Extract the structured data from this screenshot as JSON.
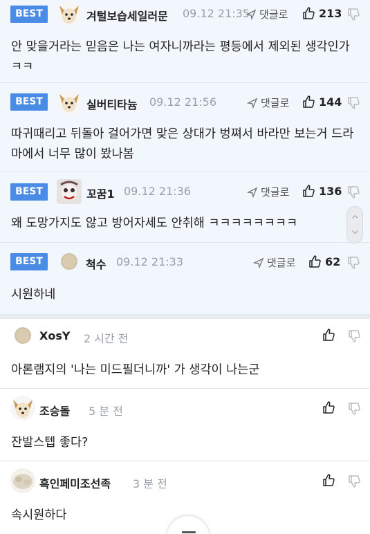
{
  "best_comments": [
    {
      "badge": "BEST",
      "author": "겨털보습세일러문",
      "date": "09.12 21:35",
      "reply_label": "댓글로",
      "likes": "213",
      "text": "안 맞을거라는 믿음은 나는 여자니까라는 평등에서 제외된 생각인가ㅋㅋ",
      "avatar": "dog-avatar"
    },
    {
      "badge": "BEST",
      "author": "실버티타늄",
      "date": "09.12 21:56",
      "reply_label": "댓글로",
      "likes": "144",
      "text": "따귀때리고 뒤돌아 걸어가면 맞은 상대가 벙쪄서 바라만 보는거 드라마에서 너무 많이 봤나봄",
      "avatar": "dog-avatar"
    },
    {
      "badge": "BEST",
      "author": "꼬꿈1",
      "date": "09.12 21:36",
      "reply_label": "댓글로",
      "likes": "136",
      "text": "왜 도망가지도 않고 방어자세도 안취해 ㅋㅋㅋㅋㅋㅋㅋㅋ",
      "avatar": "clown-avatar"
    },
    {
      "badge": "BEST",
      "author": "척수",
      "date": "09.12 21:33",
      "reply_label": "댓글로",
      "likes": "62",
      "text": "시원하네",
      "avatar": "default-avatar"
    }
  ],
  "comments": [
    {
      "author": "XosY",
      "date": "2 시간 전",
      "text": "아론램지의 '나는 미드필더니까' 가 생각이 나는군",
      "avatar": "default-avatar"
    },
    {
      "author": "조승돌",
      "date": "5 분 전",
      "text": "잔발스텝 좋다?",
      "avatar": "dog-avatar"
    },
    {
      "author": "흑인페미조선족",
      "date": "3 분 전",
      "text": "속시원하다",
      "avatar": "blur-avatar"
    }
  ],
  "colors": {
    "best_bg": "#f2f6fd",
    "badge": "#4a8be6",
    "muted": "#9aa0a8"
  }
}
